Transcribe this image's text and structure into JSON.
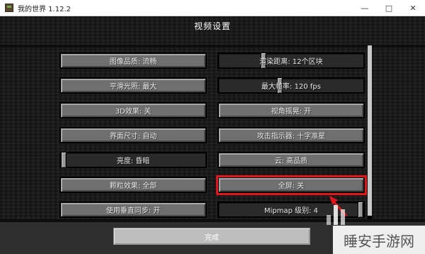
{
  "window": {
    "title": "我的世界 1.12.2",
    "minimize": "—",
    "maximize": "□",
    "close": "✕"
  },
  "screen": {
    "title": "视频设置",
    "done_label": "完成"
  },
  "settings": {
    "graphics": "图像品质: 流畅",
    "render_distance": "渲染距离: 12个区块",
    "smooth_lighting": "平滑光照: 最大",
    "max_framerate": "最大帧率: 120 fps",
    "three_d": "3D效果: 关",
    "view_bobbing": "视角摇晃: 开",
    "gui_scale": "界面尺寸: 自动",
    "attack_indicator": "攻击指示器: 十字准星",
    "brightness": "亮度: 昏暗",
    "clouds": "云: 高品质",
    "particles": "颗粒效果: 全部",
    "fullscreen": "全屏: 关",
    "vsync": "使用垂直同步: 开",
    "mipmap": "Mipmap 级别: 4"
  },
  "slider_levels": {
    "render_distance": 0.3,
    "max_framerate": 0.42,
    "brightness": 0.0,
    "mipmap": 1.0
  },
  "colors": {
    "highlight": "#e0161b",
    "button": "#6f6f6f",
    "slider_bg": "#2a2a2a"
  },
  "watermark": "睡安手游网"
}
